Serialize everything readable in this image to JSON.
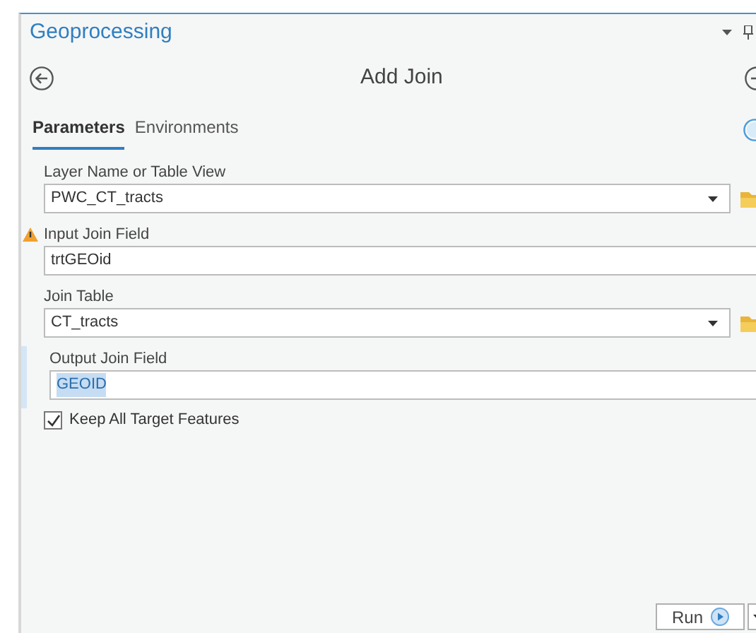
{
  "pane": {
    "title": "Geoprocessing"
  },
  "tool": {
    "title": "Add Join"
  },
  "tabs": [
    {
      "label": "Parameters",
      "selected": true
    },
    {
      "label": "Environments",
      "selected": false
    }
  ],
  "parameters": [
    {
      "label": "Layer Name or Table View",
      "value": "PWC_CT_tracts",
      "warning": false,
      "browse": true,
      "focused": false
    },
    {
      "label": "Input Join Field",
      "value": "trtGEOid",
      "warning": true,
      "browse": false,
      "focused": false
    },
    {
      "label": "Join Table",
      "value": "CT_tracts",
      "warning": false,
      "browse": true,
      "focused": false
    },
    {
      "label": "Output Join Field",
      "value": "GEOID",
      "warning": false,
      "browse": false,
      "focused": true
    }
  ],
  "keep_all": {
    "label": "Keep All Target Features",
    "checked": true
  },
  "run_button": {
    "label": "Run"
  }
}
